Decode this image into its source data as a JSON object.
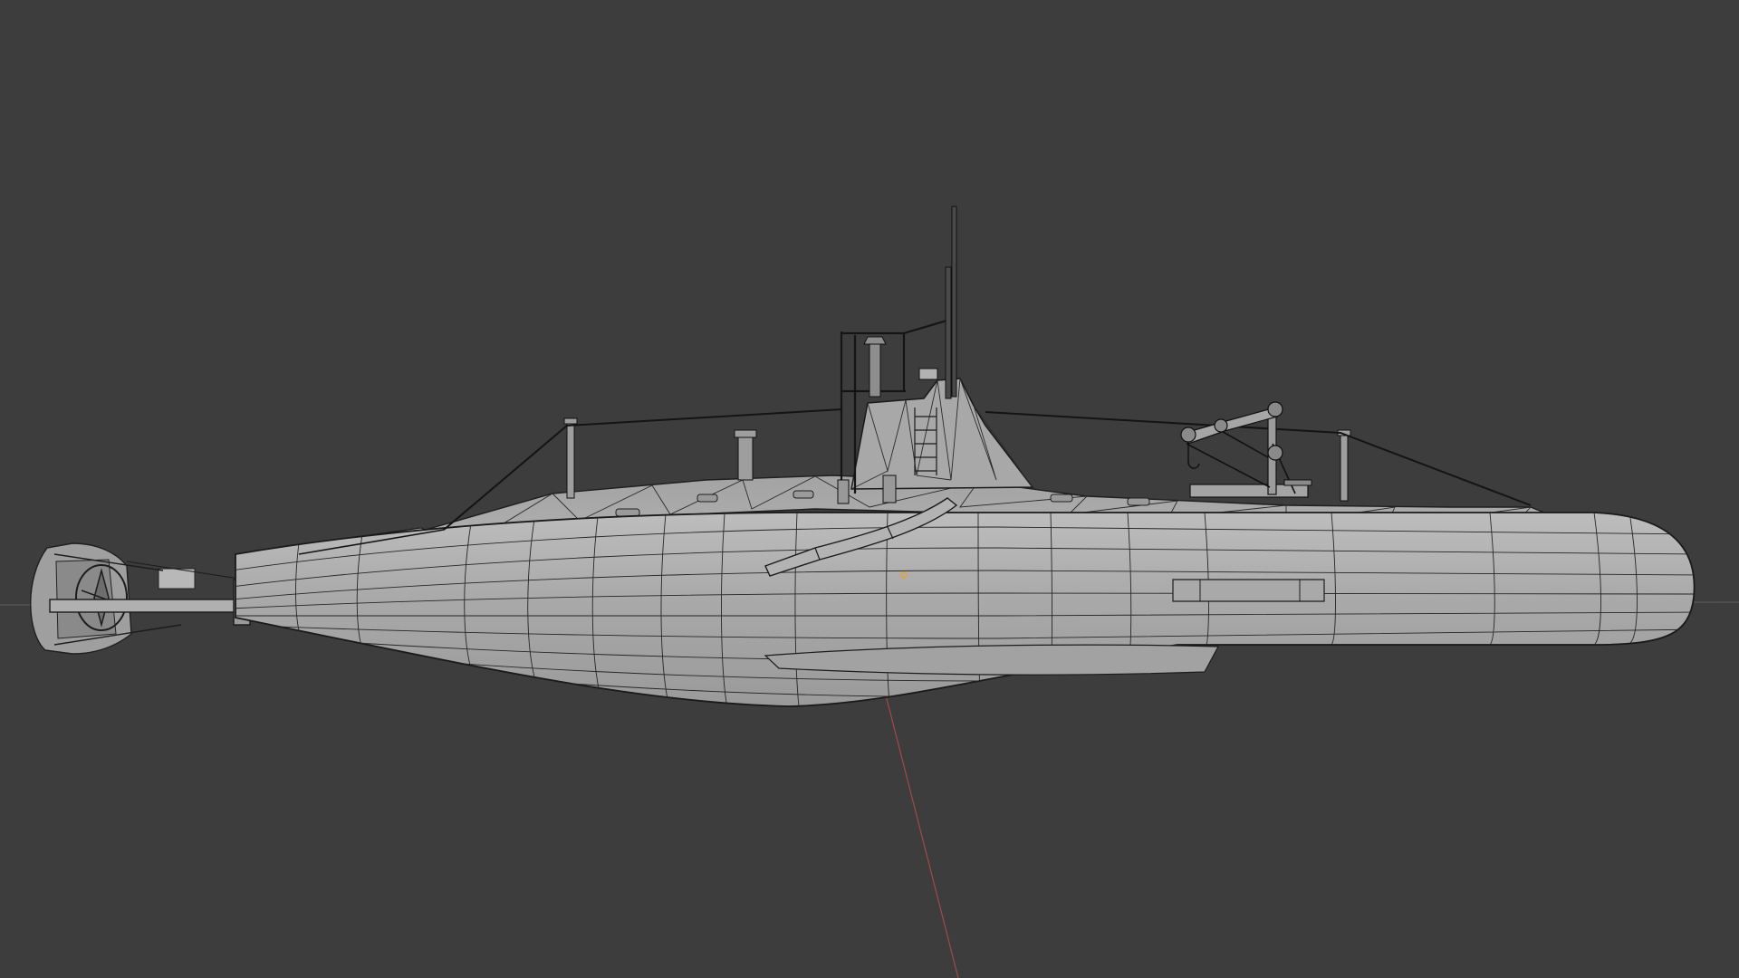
{
  "viewport": {
    "background_color": "#3d3d3d",
    "object_fill_color": "#a7a7a7",
    "object_light_color": "#bdbdbd",
    "wire_color": "#1f1f1f",
    "rail_color": "#141414",
    "horizon_axis_color": "#5e5e5e",
    "vertical_axis_color": "#a14a48",
    "origin_color": "#e8a030"
  },
  "scene": {
    "object": "submarine-wireframe-model",
    "view": "side-orthographic",
    "shading": "solid-with-wireframe-overlay"
  }
}
